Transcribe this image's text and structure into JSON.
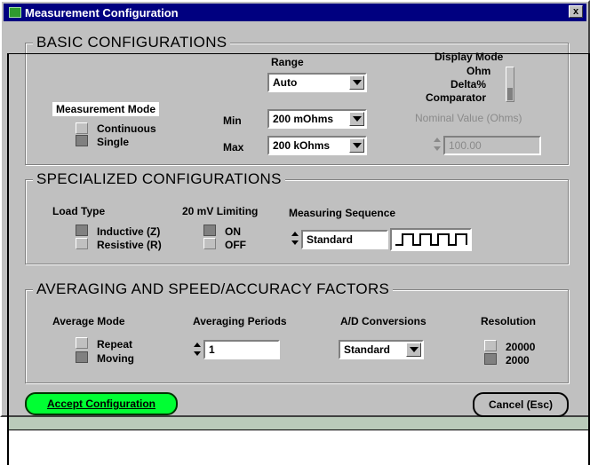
{
  "window": {
    "title": "Measurement Configuration",
    "close_label": "x"
  },
  "basic": {
    "legend": "BASIC CONFIGURATIONS",
    "range_label": "Range",
    "range_value": "Auto",
    "min_label": "Min",
    "min_value": "200 mOhms",
    "max_label": "Max",
    "max_value": "200 kOhms",
    "mode_label": "Measurement Mode",
    "mode_options": [
      "Continuous",
      "Single"
    ],
    "mode_selected": "Single",
    "display_label": "Display Mode",
    "display_options": [
      "Ohm",
      "Delta%",
      "Comparator"
    ],
    "nominal_label": "Nominal Value (Ohms)",
    "nominal_value": "100.00"
  },
  "specialized": {
    "legend": "SPECIALIZED CONFIGURATIONS",
    "load_label": "Load Type",
    "load_options": [
      "Inductive (Z)",
      "Resistive (R)"
    ],
    "load_selected": "Inductive (Z)",
    "limit_label": "20 mV Limiting",
    "limit_options": [
      "ON",
      "OFF"
    ],
    "limit_selected": "ON",
    "sequence_label": "Measuring Sequence",
    "sequence_value": "Standard"
  },
  "averaging": {
    "legend": "AVERAGING AND SPEED/ACCURACY FACTORS",
    "avg_mode_label": "Average Mode",
    "avg_mode_options": [
      "Repeat",
      "Moving"
    ],
    "avg_mode_selected": "Moving",
    "periods_label": "Averaging Periods",
    "periods_value": "1",
    "ad_label": "A/D Conversions",
    "ad_value": "Standard",
    "resolution_label": "Resolution",
    "resolution_options": [
      "20000",
      "2000"
    ],
    "resolution_selected": "2000"
  },
  "buttons": {
    "accept": "Accept Configuration",
    "cancel": "Cancel (Esc)"
  },
  "colors": {
    "titlebar": "#000080",
    "accept": "#00ff33",
    "face": "#c0c0c0"
  }
}
